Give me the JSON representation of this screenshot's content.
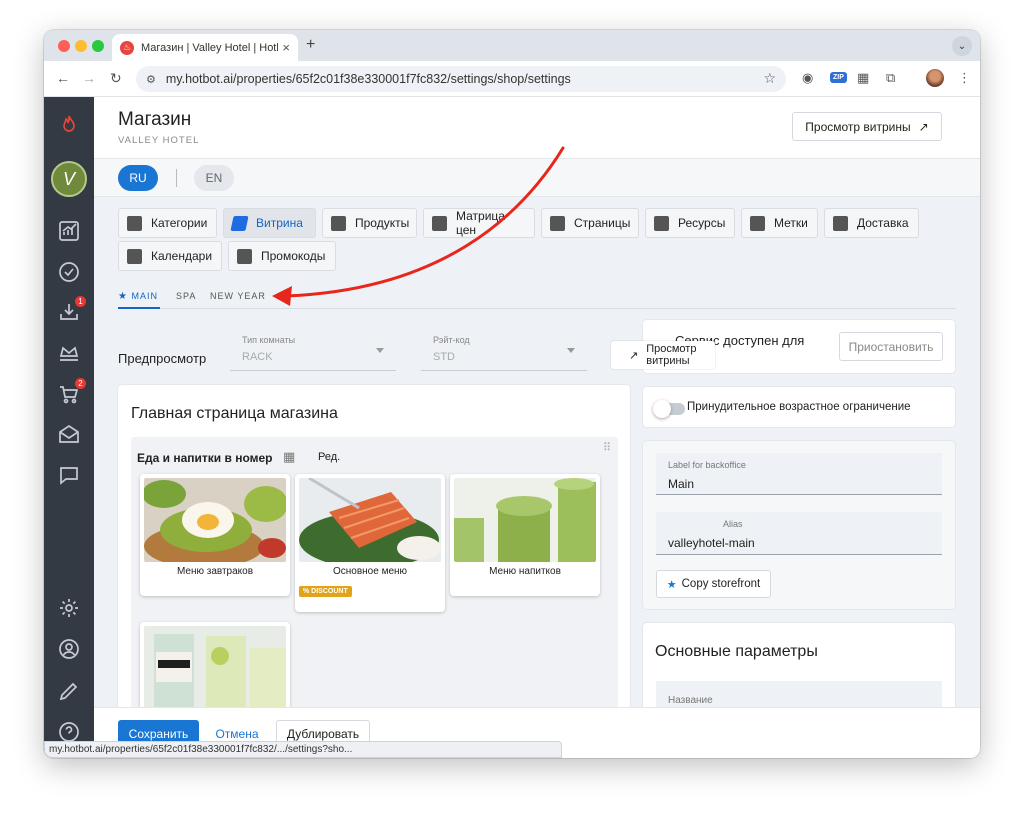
{
  "browser": {
    "tab_title": "Магазин | Valley Hotel | Hotbot",
    "tab_close": "×",
    "new_tab": "+",
    "url": "my.hotbot.ai/properties/65f2c01f38e330001f7fc832/settings/shop/settings",
    "status_url": "my.hotbot.ai/properties/65f2c01f38e330001f7fc832/.../settings?sho...",
    "zip_label": "ZIP"
  },
  "sidebar": {
    "badges": {
      "downloads": "1",
      "cart": "2"
    }
  },
  "header": {
    "title": "Магазин",
    "subtitle": "VALLEY HOTEL",
    "preview_button": "Просмотр витрины",
    "preview_arrow": "↗"
  },
  "languages": {
    "ru": "RU",
    "en": "EN"
  },
  "nav_tabs": [
    {
      "label": "Категории"
    },
    {
      "label": "Витрина"
    },
    {
      "label": "Продукты"
    },
    {
      "label": "Матрица цен"
    },
    {
      "label": "Страницы"
    },
    {
      "label": "Ресурсы"
    },
    {
      "label": "Метки"
    },
    {
      "label": "Доставка"
    },
    {
      "label": "Календари"
    },
    {
      "label": "Промокоды"
    }
  ],
  "sub_tabs": [
    {
      "label": "MAIN"
    },
    {
      "label": "SPA"
    },
    {
      "label": "NEW YEAR"
    }
  ],
  "preview": {
    "label": "Предпросмотр",
    "room_type_label": "Тип комнаты",
    "room_type_value": "RACK",
    "rate_code_label": "Рэйт-код",
    "rate_code_value": "STD",
    "preview_button": "Просмотр витрины",
    "preview_arrow": "↗"
  },
  "main_page": {
    "title": "Главная страница магазина",
    "section_title": "Еда и напитки в номер",
    "edit_label": "Ред.",
    "products": [
      {
        "name": "Меню завтраков"
      },
      {
        "name": "Основное меню",
        "badge": "DISCOUNT"
      },
      {
        "name": "Меню напитков"
      },
      {
        "name": ""
      }
    ]
  },
  "right_panel": {
    "service_text": "Сервис доступен для",
    "suspend_button": "Приостановить",
    "age_restriction": "Принудительное возрастное ограничение",
    "backoffice_label": "Label for backoffice",
    "backoffice_value": "Main",
    "alias_label": "Alias",
    "alias_value": "valleyhotel-main",
    "copy_button": "Copy storefront",
    "params_title": "Основные параметры",
    "name_label": "Название"
  },
  "footer": {
    "save": "Сохранить",
    "cancel": "Отмена",
    "duplicate": "Дублировать"
  },
  "colors": {
    "primary": "#1976d2",
    "sidebar": "#343a44",
    "annotation_arrow": "#e8271c",
    "discount": "#e0a31a",
    "badge": "#e53935"
  }
}
